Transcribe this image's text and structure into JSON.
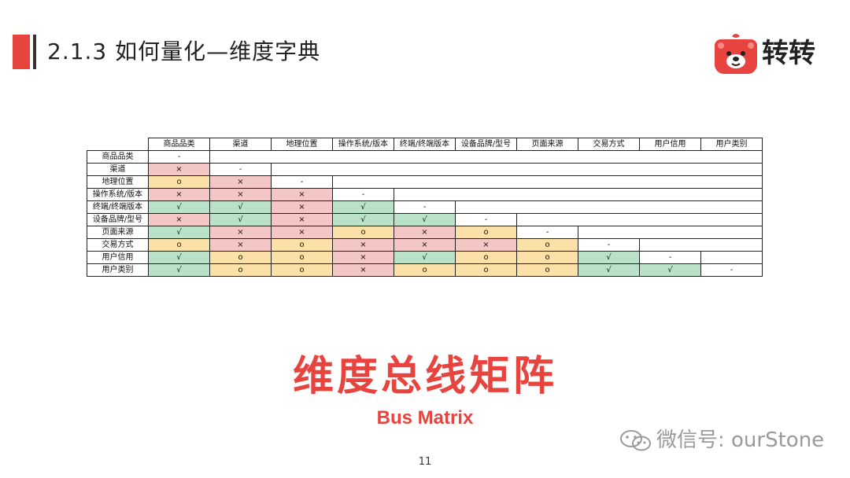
{
  "title": "2.1.3 如何量化—维度字典",
  "logo_text": "转转",
  "matrix": {
    "columns": [
      "商品品类",
      "渠道",
      "地理位置",
      "操作系统/版本",
      "终端/终端版本",
      "设备品牌/型号",
      "页面来源",
      "交易方式",
      "用户信用",
      "用户类别"
    ],
    "rows": [
      {
        "label": "商品品类",
        "cells": [
          "-"
        ]
      },
      {
        "label": "渠道",
        "cells": [
          "×",
          "-"
        ]
      },
      {
        "label": "地理位置",
        "cells": [
          "o",
          "×",
          "-"
        ]
      },
      {
        "label": "操作系统/版本",
        "cells": [
          "×",
          "×",
          "×",
          "-"
        ]
      },
      {
        "label": "终端/终端版本",
        "cells": [
          "√",
          "√",
          "×",
          "√",
          "-"
        ]
      },
      {
        "label": "设备品牌/型号",
        "cells": [
          "×",
          "√",
          "×",
          "√",
          "√",
          "-"
        ]
      },
      {
        "label": "页面来源",
        "cells": [
          "√",
          "×",
          "×",
          "o",
          "×",
          "o",
          "-"
        ]
      },
      {
        "label": "交易方式",
        "cells": [
          "o",
          "×",
          "o",
          "×",
          "×",
          "×",
          "o",
          "-"
        ]
      },
      {
        "label": "用户信用",
        "cells": [
          "√",
          "o",
          "o",
          "×",
          "√",
          "o",
          "o",
          "√",
          "-"
        ]
      },
      {
        "label": "用户类别",
        "cells": [
          "√",
          "o",
          "o",
          "×",
          "o",
          "o",
          "o",
          "√",
          "√",
          "-"
        ]
      }
    ]
  },
  "colors": {
    "accent_red": "#e8443f",
    "cell_cross": "#f5c6c6",
    "cell_check": "#b9e2c9",
    "cell_circle": "#fbe0a8"
  },
  "big_title": "维度总线矩阵",
  "sub_title": "Bus Matrix",
  "watermark": "微信号: ourStone",
  "page_number": "11"
}
